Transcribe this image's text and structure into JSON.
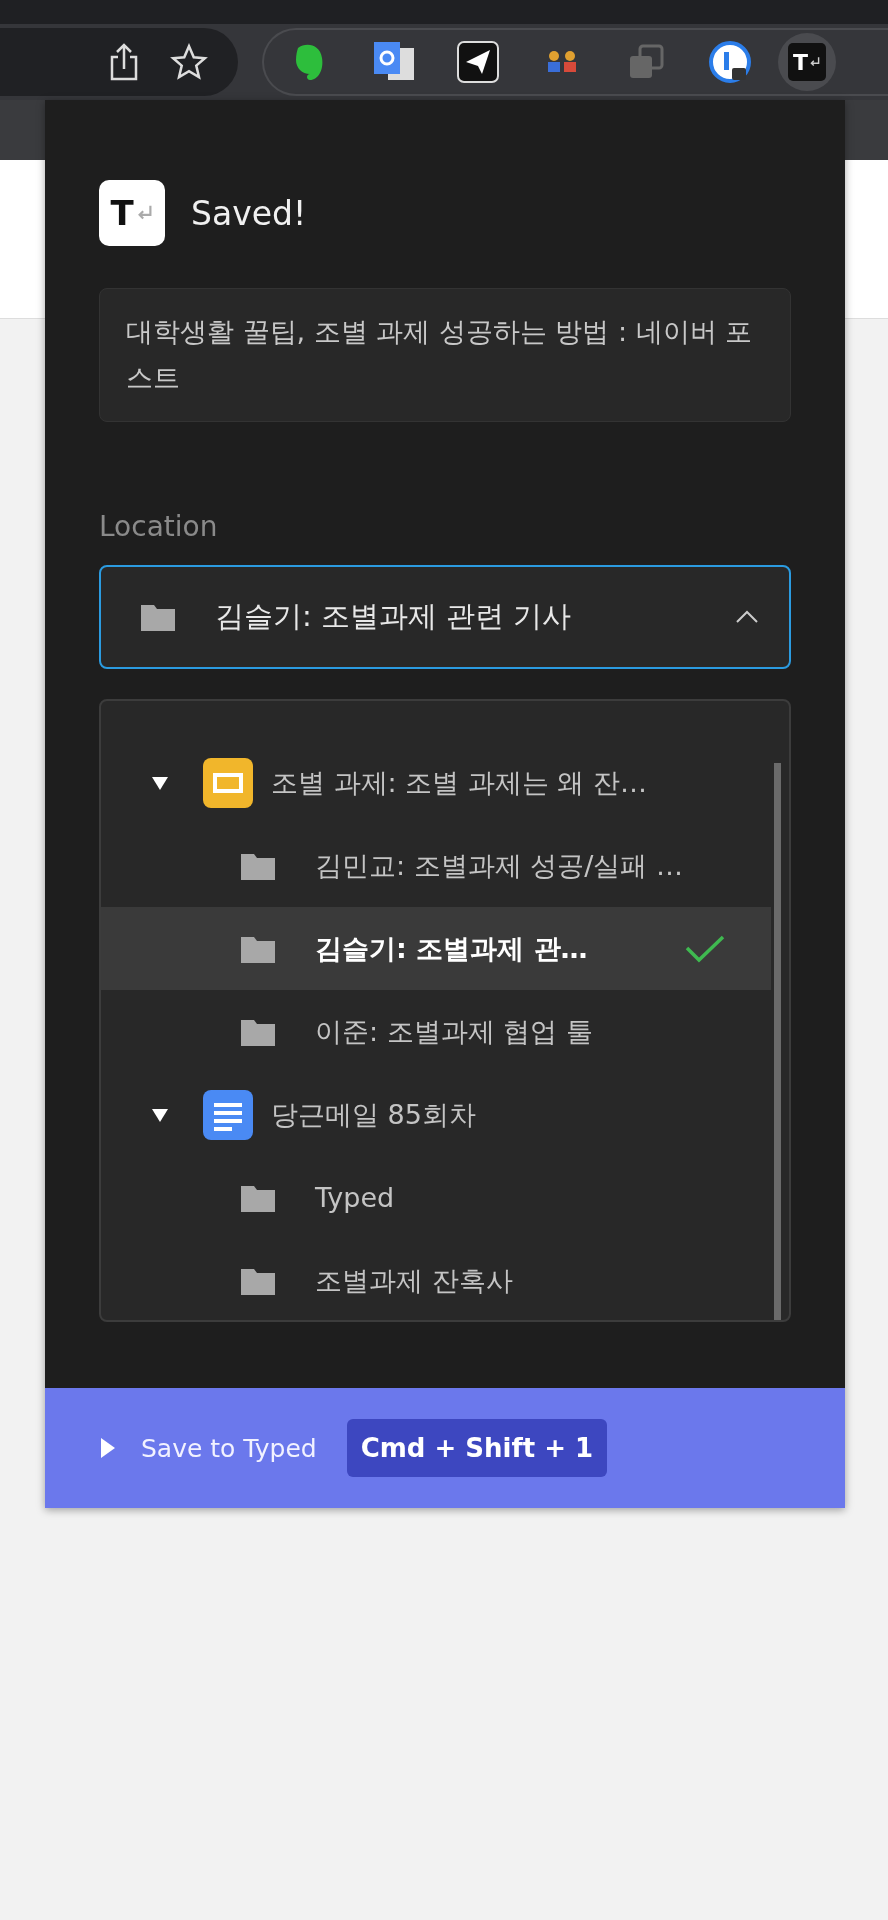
{
  "toolbar": {
    "active_extension_mark": "T"
  },
  "popup": {
    "logo_mark": "T",
    "title": "Saved!",
    "page_title": "대학생활 꿀팁, 조별 과제 성공하는 방법 : 네이버 포스트",
    "location_label": "Location",
    "location_select": {
      "value": "김슬기: 조별과제 관련 기사",
      "expanded": true
    },
    "tree": [
      {
        "label": "조별 과제: 조별 과제는 왜 잔…",
        "kind": "slides",
        "expanded": true,
        "selected": false,
        "children": [
          {
            "label": "김민교: 조별과제 성공/실패 …",
            "kind": "folder",
            "selected": false
          },
          {
            "label": "김슬기: 조별과제 관…",
            "kind": "folder",
            "selected": true
          },
          {
            "label": "이준: 조별과제 협업 툴",
            "kind": "folder",
            "selected": false
          }
        ]
      },
      {
        "label": "당근메일 85회차",
        "kind": "doc",
        "expanded": true,
        "selected": false,
        "children": [
          {
            "label": "Typed",
            "kind": "folder",
            "selected": false
          },
          {
            "label": "조별과제 잔혹사",
            "kind": "folder",
            "selected": false
          }
        ]
      }
    ],
    "footer": {
      "label": "Save to Typed",
      "shortcut": "Cmd + Shift + 1"
    }
  }
}
